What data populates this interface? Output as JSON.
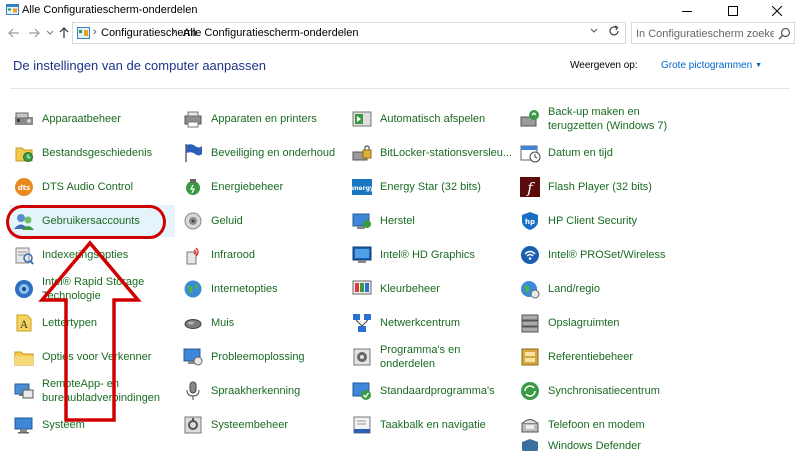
{
  "window": {
    "title": "Alle Configuratiescherm-onderdelen",
    "controls": {
      "minimize": "—",
      "maximize": "☐",
      "close": "✕"
    }
  },
  "address": {
    "crumbs": [
      "Configuratiescherm",
      "Alle Configuratiescherm-onderdelen"
    ],
    "search_placeholder": "In Configuratiescherm zoeken"
  },
  "header": {
    "title": "De instellingen van de computer aanpassen",
    "view_by_label": "Weergeven op:",
    "view_by_value": "Grote pictogrammen"
  },
  "items": [
    {
      "label": "Apparaatbeheer",
      "icon": "device-manager-icon"
    },
    {
      "label": "Bestandsgeschiedenis",
      "icon": "file-history-icon"
    },
    {
      "label": "DTS Audio Control",
      "icon": "dts-audio-icon"
    },
    {
      "label": "Gebruikersaccounts",
      "icon": "user-accounts-icon"
    },
    {
      "label": "Indexeringsopties",
      "icon": "indexing-icon"
    },
    {
      "label": "Intel® Rapid Storage Technologie",
      "icon": "rapid-storage-icon"
    },
    {
      "label": "Lettertypen",
      "icon": "fonts-icon"
    },
    {
      "label": "Opties voor Verkenner",
      "icon": "explorer-options-icon"
    },
    {
      "label": "RemoteApp- en bureaubladverbindingen",
      "icon": "remoteapp-icon"
    },
    {
      "label": "Systeem",
      "icon": "system-icon"
    },
    {
      "label": "Apparaten en printers",
      "icon": "devices-printers-icon"
    },
    {
      "label": "Beveiliging en onderhoud",
      "icon": "security-maintenance-icon"
    },
    {
      "label": "Energiebeheer",
      "icon": "power-options-icon"
    },
    {
      "label": "Geluid",
      "icon": "sound-icon"
    },
    {
      "label": "Infrarood",
      "icon": "infrared-icon"
    },
    {
      "label": "Internetopties",
      "icon": "internet-options-icon"
    },
    {
      "label": "Muis",
      "icon": "mouse-icon"
    },
    {
      "label": "Probleemoplossing",
      "icon": "troubleshooting-icon"
    },
    {
      "label": "Spraakherkenning",
      "icon": "speech-recognition-icon"
    },
    {
      "label": "Systeembeheer",
      "icon": "admin-tools-icon"
    },
    {
      "label": "Automatisch afspelen",
      "icon": "autoplay-icon"
    },
    {
      "label": "BitLocker-stationsversleu...",
      "icon": "bitlocker-icon"
    },
    {
      "label": "Energy Star (32 bits)",
      "icon": "energy-star-icon"
    },
    {
      "label": "Herstel",
      "icon": "recovery-icon"
    },
    {
      "label": "Intel® HD Graphics",
      "icon": "intel-graphics-icon"
    },
    {
      "label": "Kleurbeheer",
      "icon": "color-management-icon"
    },
    {
      "label": "Netwerkcentrum",
      "icon": "network-center-icon"
    },
    {
      "label": "Programma's en onderdelen",
      "icon": "programs-features-icon"
    },
    {
      "label": "Standaardprogramma's",
      "icon": "default-programs-icon"
    },
    {
      "label": "Taakbalk en navigatie",
      "icon": "taskbar-icon"
    },
    {
      "label": "Back-up maken en terugzetten (Windows 7)",
      "icon": "backup-restore-icon"
    },
    {
      "label": "Datum en tijd",
      "icon": "date-time-icon"
    },
    {
      "label": "Flash Player (32 bits)",
      "icon": "flash-player-icon"
    },
    {
      "label": "HP Client Security",
      "icon": "hp-client-security-icon"
    },
    {
      "label": "Intel® PROSet/Wireless",
      "icon": "intel-wireless-icon"
    },
    {
      "label": "Land/regio",
      "icon": "region-icon"
    },
    {
      "label": "Opslagruimten",
      "icon": "storage-spaces-icon"
    },
    {
      "label": "Referentiebeheer",
      "icon": "credential-manager-icon"
    },
    {
      "label": "Synchronisatiecentrum",
      "icon": "sync-center-icon"
    },
    {
      "label": "Telefoon en modem",
      "icon": "phone-modem-icon"
    },
    {
      "label": "Windows Defender",
      "icon": "windows-defender-icon"
    }
  ],
  "colors": {
    "link": "#1a6b22",
    "title": "#1e3287",
    "accent": "#0066cc",
    "annotation": "#d00000",
    "highlight": "#e5f3fb"
  }
}
